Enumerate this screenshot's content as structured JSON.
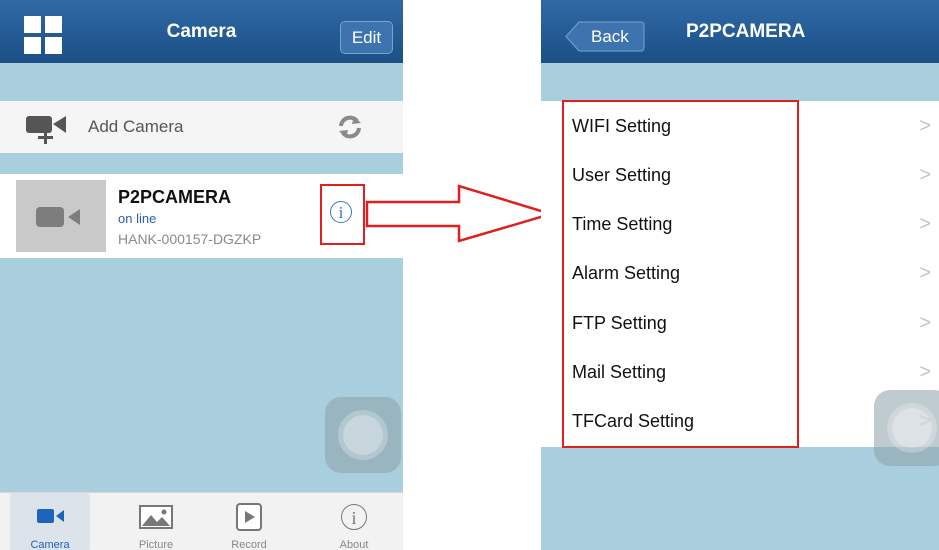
{
  "left_screen": {
    "title": "Camera",
    "edit_label": "Edit",
    "add_camera_label": "Add Camera",
    "camera": {
      "name": "P2PCAMERA",
      "status": "on line",
      "id": "HANK-000157-DGZKP"
    },
    "tabs": [
      {
        "label": "Camera",
        "icon": "video-camera-icon",
        "active": true
      },
      {
        "label": "Picture",
        "icon": "picture-icon",
        "active": false
      },
      {
        "label": "Record",
        "icon": "record-icon",
        "active": false
      },
      {
        "label": "About",
        "icon": "info-icon",
        "active": false
      }
    ]
  },
  "right_screen": {
    "back_label": "Back",
    "title": "P2PCAMERA",
    "menu": [
      "WIFI Setting",
      "User Setting",
      "Time Setting",
      "Alarm Setting",
      "FTP Setting",
      "Mail Setting",
      "TFCard Setting"
    ]
  },
  "colors": {
    "navbar": "#1c4f86",
    "background": "#a9cedd",
    "highlight": "#e01f1f",
    "link": "#3b78c4"
  }
}
